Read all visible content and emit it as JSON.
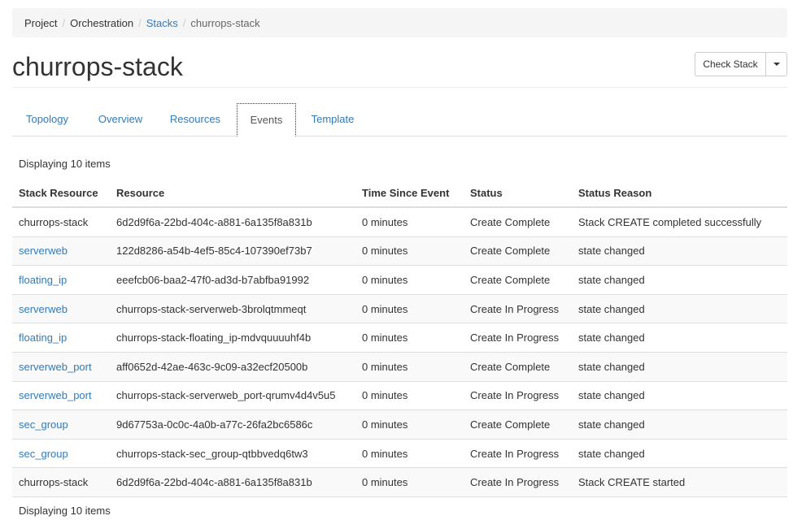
{
  "breadcrumb": {
    "items": [
      "Project",
      "Orchestration",
      "Stacks",
      "churrops-stack"
    ],
    "separator": "/"
  },
  "page": {
    "title": "churrops-stack"
  },
  "actions": {
    "check_stack_label": "Check Stack"
  },
  "tabs": [
    {
      "label": "Topology",
      "active": false
    },
    {
      "label": "Overview",
      "active": false
    },
    {
      "label": "Resources",
      "active": false
    },
    {
      "label": "Events",
      "active": true
    },
    {
      "label": "Template",
      "active": false
    }
  ],
  "table": {
    "count_text": "Displaying 10 items",
    "columns": [
      "Stack Resource",
      "Resource",
      "Time Since Event",
      "Status",
      "Status Reason"
    ],
    "rows": [
      {
        "stack_resource": "churrops-stack",
        "link": false,
        "resource": "6d2d9f6a-22bd-404c-a881-6a135f8a831b",
        "time": "0 minutes",
        "status": "Create Complete",
        "reason": "Stack CREATE completed successfully"
      },
      {
        "stack_resource": "serverweb",
        "link": true,
        "resource": "122d8286-a54b-4ef5-85c4-107390ef73b7",
        "time": "0 minutes",
        "status": "Create Complete",
        "reason": "state changed"
      },
      {
        "stack_resource": "floating_ip",
        "link": true,
        "resource": "eeefcb06-baa2-47f0-ad3d-b7abfba91992",
        "time": "0 minutes",
        "status": "Create Complete",
        "reason": "state changed"
      },
      {
        "stack_resource": "serverweb",
        "link": true,
        "resource": "churrops-stack-serverweb-3brolqtmmeqt",
        "time": "0 minutes",
        "status": "Create In Progress",
        "reason": "state changed"
      },
      {
        "stack_resource": "floating_ip",
        "link": true,
        "resource": "churrops-stack-floating_ip-mdvquuuuhf4b",
        "time": "0 minutes",
        "status": "Create In Progress",
        "reason": "state changed"
      },
      {
        "stack_resource": "serverweb_port",
        "link": true,
        "resource": "aff0652d-42ae-463c-9c09-a32ecf20500b",
        "time": "0 minutes",
        "status": "Create Complete",
        "reason": "state changed"
      },
      {
        "stack_resource": "serverweb_port",
        "link": true,
        "resource": "churrops-stack-serverweb_port-qrumv4d4v5u5",
        "time": "0 minutes",
        "status": "Create In Progress",
        "reason": "state changed"
      },
      {
        "stack_resource": "sec_group",
        "link": true,
        "resource": "9d67753a-0c0c-4a0b-a77c-26fa2bc6586c",
        "time": "0 minutes",
        "status": "Create Complete",
        "reason": "state changed"
      },
      {
        "stack_resource": "sec_group",
        "link": true,
        "resource": "churrops-stack-sec_group-qtbbvedq6tw3",
        "time": "0 minutes",
        "status": "Create In Progress",
        "reason": "state changed"
      },
      {
        "stack_resource": "churrops-stack",
        "link": false,
        "resource": "6d2d9f6a-22bd-404c-a881-6a135f8a831b",
        "time": "0 minutes",
        "status": "Create In Progress",
        "reason": "Stack CREATE started"
      }
    ]
  },
  "colors": {
    "link": "#337ab7",
    "breadcrumb_bg": "#f5f5f5",
    "stripe": "#f9f9f9"
  },
  "icons": {
    "dropdown": "caret-down-icon"
  }
}
